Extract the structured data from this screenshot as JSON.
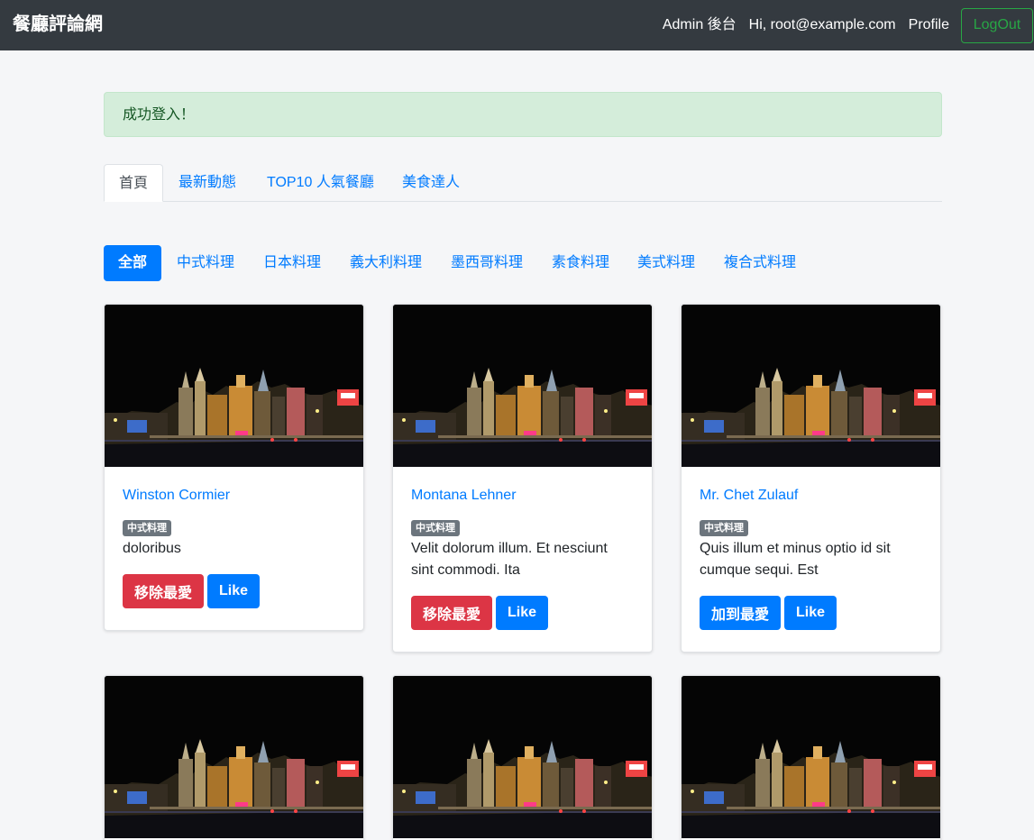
{
  "nav": {
    "brand": "餐廳評論網",
    "admin": "Admin 後台",
    "greeting": "Hi, root@example.com",
    "profile": "Profile",
    "logout": "LogOut"
  },
  "alert": {
    "message": "成功登入！"
  },
  "tabs": [
    {
      "label": "首頁"
    },
    {
      "label": "最新動態"
    },
    {
      "label": "TOP10 人氣餐廳"
    },
    {
      "label": "美食達人"
    }
  ],
  "categories": [
    {
      "label": "全部"
    },
    {
      "label": "中式料理"
    },
    {
      "label": "日本料理"
    },
    {
      "label": "義大利料理"
    },
    {
      "label": "墨西哥料理"
    },
    {
      "label": "素食料理"
    },
    {
      "label": "美式料理"
    },
    {
      "label": "複合式料理"
    }
  ],
  "restaurants": [
    {
      "name": "Winston Cormier",
      "category": "中式料理",
      "description": "doloribus",
      "favorite_label": "移除最愛",
      "like_label": "Like"
    },
    {
      "name": "Montana Lehner",
      "category": "中式料理",
      "description": "Velit dolorum illum. Et nesciunt sint commodi. Ita",
      "favorite_label": "移除最愛",
      "like_label": "Like"
    },
    {
      "name": "Mr. Chet Zulauf",
      "category": "中式料理",
      "description": "Quis illum et minus optio id sit cumque sequi. Est",
      "favorite_label": "加到最愛",
      "like_label": "Like"
    }
  ],
  "colors": {
    "navbar": "#343a40",
    "primary": "#007bff",
    "danger": "#dc3545",
    "success": "#28a745",
    "alert_bg": "#d4edda"
  }
}
